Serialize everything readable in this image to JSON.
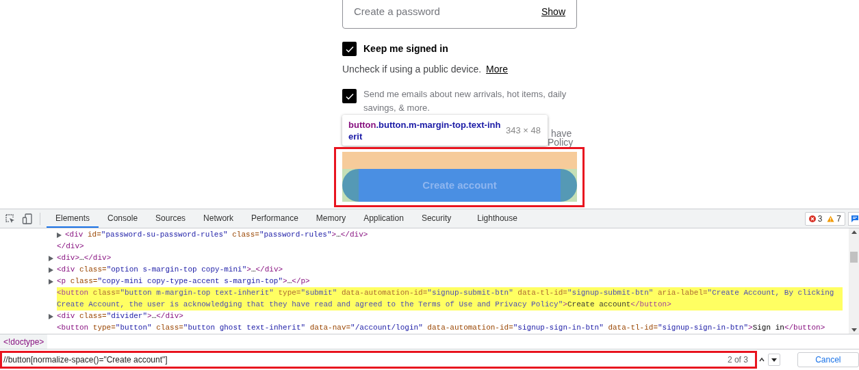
{
  "signup_form": {
    "password_field": {
      "placeholder": "Create a password",
      "toggle_link": "Show"
    },
    "keep_signed_in": {
      "label": "Keep me signed in",
      "checked": true
    },
    "keep_hint": {
      "text": "Uncheck if using a public device.",
      "link": "More"
    },
    "marketing_emails": {
      "label": "Send me emails about new arrivals, hot items, daily savings, & more.",
      "checked": true
    },
    "obscured_text": [
      "have",
      "Policy"
    ],
    "submit_button": "Create account"
  },
  "inspect_tooltip": {
    "tag": "button",
    "classes": ".button.m-margin-top.text-inherit",
    "size": "343 × 48"
  },
  "devtools": {
    "tabs": [
      {
        "label": "Elements",
        "selected": true
      },
      {
        "label": "Console",
        "selected": false
      },
      {
        "label": "Sources",
        "selected": false
      },
      {
        "label": "Network",
        "selected": false
      },
      {
        "label": "Performance",
        "selected": false
      },
      {
        "label": "Memory",
        "selected": false
      },
      {
        "label": "Application",
        "selected": false
      },
      {
        "label": "Security",
        "selected": false
      },
      {
        "label": "Lighthouse",
        "selected": false
      }
    ],
    "issues": {
      "errors": "3",
      "warnings": "7"
    },
    "dom_tree": [
      {
        "closing": [
          {
            "kind": "tag",
            "text": "</div>"
          }
        ],
        "children": [
          {
            "expandable": true,
            "highlighted": false,
            "parts": [
              {
                "kind": "tag",
                "text": "<div "
              },
              {
                "kind": "attr",
                "text": "id="
              },
              {
                "kind": "value",
                "text": "\"password-su-password-rules\""
              },
              {
                "kind": "attr",
                "text": " class="
              },
              {
                "kind": "value",
                "text": "\"password-rules\""
              },
              {
                "kind": "tag",
                "text": ">"
              },
              {
                "kind": "text",
                "text": "…"
              },
              {
                "kind": "tag",
                "text": "</div>"
              }
            ]
          }
        ]
      },
      {
        "expandable": true,
        "highlighted": false,
        "parts": [
          {
            "kind": "tag",
            "text": "<div>"
          },
          {
            "kind": "text",
            "text": "…"
          },
          {
            "kind": "tag",
            "text": "</div>"
          }
        ]
      },
      {
        "expandable": true,
        "highlighted": false,
        "parts": [
          {
            "kind": "tag",
            "text": "<div "
          },
          {
            "kind": "attr",
            "text": "class="
          },
          {
            "kind": "value",
            "text": "\"option s-margin-top copy-mini\""
          },
          {
            "kind": "tag",
            "text": ">"
          },
          {
            "kind": "text",
            "text": "…"
          },
          {
            "kind": "tag",
            "text": "</div>"
          }
        ]
      },
      {
        "expandable": true,
        "highlighted": false,
        "parts": [
          {
            "kind": "tag",
            "text": "<p "
          },
          {
            "kind": "attr",
            "text": "class="
          },
          {
            "kind": "value",
            "text": "\"copy-mini copy-type-accent s-margin-top\""
          },
          {
            "kind": "tag",
            "text": ">"
          },
          {
            "kind": "text",
            "text": "…"
          },
          {
            "kind": "tag",
            "text": "</p>"
          }
        ]
      },
      {
        "expandable": false,
        "highlighted": true,
        "parts": [
          {
            "kind": "tag",
            "text": "<button "
          },
          {
            "kind": "attr",
            "text": "class="
          },
          {
            "kind": "value",
            "text": "\"button m-margin-top text-inherit\""
          },
          {
            "kind": "attr",
            "text": " type="
          },
          {
            "kind": "value",
            "text": "\"submit\""
          },
          {
            "kind": "attr",
            "text": " data-automation-id="
          },
          {
            "kind": "value",
            "text": "\"signup-submit-btn\""
          },
          {
            "kind": "attr",
            "text": " data-tl-id="
          },
          {
            "kind": "value",
            "text": "\"signup-submit-btn\""
          },
          {
            "kind": "attr",
            "text": " aria-label="
          },
          {
            "kind": "value",
            "text": "\"Create Account, By clicking Create Account, the user is acknowledging that they have read and agreed to the Terms of Use and Privacy Policy\""
          },
          {
            "kind": "tag",
            "text": ">"
          },
          {
            "kind": "text",
            "text": "Create account"
          },
          {
            "kind": "tag",
            "text": "</button>"
          }
        ]
      },
      {
        "expandable": true,
        "highlighted": false,
        "parts": [
          {
            "kind": "tag",
            "text": "<div "
          },
          {
            "kind": "attr",
            "text": "class="
          },
          {
            "kind": "value",
            "text": "\"divider\""
          },
          {
            "kind": "tag",
            "text": ">"
          },
          {
            "kind": "text",
            "text": "…"
          },
          {
            "kind": "tag",
            "text": "</div>"
          }
        ]
      },
      {
        "expandable": false,
        "highlighted": false,
        "parts": [
          {
            "kind": "tag",
            "text": "<button "
          },
          {
            "kind": "attr",
            "text": "type="
          },
          {
            "kind": "value",
            "text": "\"button\""
          },
          {
            "kind": "attr",
            "text": " class="
          },
          {
            "kind": "value",
            "text": "\"button ghost text-inherit\""
          },
          {
            "kind": "attr",
            "text": " data-nav="
          },
          {
            "kind": "value",
            "text": "\"/account/login\""
          },
          {
            "kind": "attr",
            "text": " data-automation-id="
          },
          {
            "kind": "value",
            "text": "\"signup-sign-in-btn\""
          },
          {
            "kind": "attr",
            "text": " data-tl-id="
          },
          {
            "kind": "value",
            "text": "\"signup-sign-in-btn\""
          },
          {
            "kind": "tag",
            "text": ">"
          },
          {
            "kind": "text",
            "text": "Sign in"
          },
          {
            "kind": "tag",
            "text": "</button>"
          }
        ]
      }
    ],
    "breadcrumb": "<!doctype>",
    "search": {
      "value": "//button[normalize-space()=\"Create account\"]",
      "match_count": "2 of 3",
      "cancel": "Cancel"
    }
  }
}
